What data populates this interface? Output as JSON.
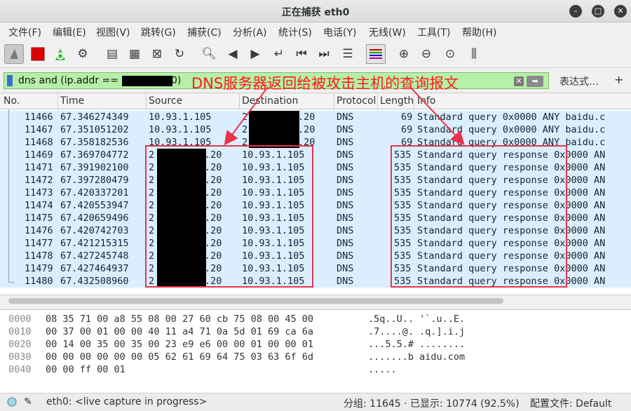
{
  "window": {
    "title": "正在捕获 eth0"
  },
  "menu": [
    "文件(F)",
    "编辑(E)",
    "视图(V)",
    "跳转(G)",
    "捕获(C)",
    "分析(A)",
    "统计(S)",
    "电话(Y)",
    "无线(W)",
    "工具(T)",
    "帮助(H)"
  ],
  "filter": {
    "text": "dns and (ip.addr == 2",
    "text_tail": "0)",
    "expression_label": "表达式…",
    "add_label": "+"
  },
  "annotation": {
    "label": "DNS服务器返回给被攻击主机的查询报文",
    "color": "#e8344a"
  },
  "columns": [
    "No.",
    "Time",
    "Source",
    "Destination",
    "Protocol",
    "Length",
    "Info"
  ],
  "packets": [
    {
      "no": "11466",
      "time": "67.346274349",
      "src": "10.93.1.105",
      "dst_head": "2",
      "dst_tail": ".20",
      "proto": "DNS",
      "len": "69",
      "info": "Standard query 0x0000 ANY baidu.c"
    },
    {
      "no": "11467",
      "time": "67.351051202",
      "src": "10.93.1.105",
      "dst_head": "2",
      "dst_tail": ".20",
      "proto": "DNS",
      "len": "69",
      "info": "Standard query 0x0000 ANY baidu.c"
    },
    {
      "no": "11468",
      "time": "67.358182536",
      "src": "10.93.1.105",
      "dst_head": "2",
      "dst_tail": ".20",
      "proto": "DNS",
      "len": "69",
      "info": "Standard query 0x0000 ANY baidu.c"
    },
    {
      "no": "11469",
      "time": "67.369704772",
      "src_head": "2",
      "src_tail": ".20",
      "dst": "10.93.1.105",
      "proto": "DNS",
      "len": "535",
      "info": "Standard query response 0x0000 AN"
    },
    {
      "no": "11471",
      "time": "67.391902100",
      "src_head": "2",
      "src_tail": ".20",
      "dst": "10.93.1.105",
      "proto": "DNS",
      "len": "535",
      "info": "Standard query response 0x0000 AN"
    },
    {
      "no": "11472",
      "time": "67.397280479",
      "src_head": "2",
      "src_tail": ".20",
      "dst": "10.93.1.105",
      "proto": "DNS",
      "len": "535",
      "info": "Standard query response 0x0000 AN"
    },
    {
      "no": "11473",
      "time": "67.420337201",
      "src_head": "2",
      "src_tail": ".20",
      "dst": "10.93.1.105",
      "proto": "DNS",
      "len": "535",
      "info": "Standard query response 0x0000 AN"
    },
    {
      "no": "11474",
      "time": "67.420553947",
      "src_head": "2",
      "src_tail": ".20",
      "dst": "10.93.1.105",
      "proto": "DNS",
      "len": "535",
      "info": "Standard query response 0x0000 AN"
    },
    {
      "no": "11475",
      "time": "67.420659496",
      "src_head": "2",
      "src_tail": ".20",
      "dst": "10.93.1.105",
      "proto": "DNS",
      "len": "535",
      "info": "Standard query response 0x0000 AN"
    },
    {
      "no": "11476",
      "time": "67.420742703",
      "src_head": "2",
      "src_tail": ".20",
      "dst": "10.93.1.105",
      "proto": "DNS",
      "len": "535",
      "info": "Standard query response 0x0000 AN"
    },
    {
      "no": "11477",
      "time": "67.421215315",
      "src_head": "2",
      "src_tail": ".20",
      "dst": "10.93.1.105",
      "proto": "DNS",
      "len": "535",
      "info": "Standard query response 0x0000 AN"
    },
    {
      "no": "11478",
      "time": "67.427245748",
      "src_head": "2",
      "src_tail": ".20",
      "dst": "10.93.1.105",
      "proto": "DNS",
      "len": "535",
      "info": "Standard query response 0x0000 AN"
    },
    {
      "no": "11479",
      "time": "67.427464937",
      "src_head": "2",
      "src_tail": ".20",
      "dst": "10.93.1.105",
      "proto": "DNS",
      "len": "535",
      "info": "Standard query response 0x0000 AN"
    },
    {
      "no": "11480",
      "time": "67.432508960",
      "src_head": "2",
      "src_tail": ".20",
      "dst": "10.93.1.105",
      "proto": "DNS",
      "len": "535",
      "info": "Standard query response 0x0000 AN"
    }
  ],
  "hex": [
    {
      "off": "0000",
      "bytes": "08 35 71 00 a8 55 08 00  27 60 cb 75 08 00 45 00",
      "ascii": ".5q..U.. '`.u..E."
    },
    {
      "off": "0010",
      "bytes": "00 37 00 01 00 00 40 11  a4 71 0a 5d 01 69 ca 6a",
      "ascii": ".7....@. .q.].i.j"
    },
    {
      "off": "0020",
      "bytes": "00 14 00 35 00 35 00 23  e9 e6 00 00 01 00 00 01",
      "ascii": "...5.5.# ........"
    },
    {
      "off": "0030",
      "bytes": "00 00 00 00 00 00 05 62  61 69 64 75 03 63 6f 6d",
      "ascii": ".......b aidu.com"
    },
    {
      "off": "0040",
      "bytes": "00 00 ff 00 01",
      "ascii": "....."
    }
  ],
  "status": {
    "interface": "eth0: <live capture in progress>",
    "counts": "分组: 11645 · 已显示: 10774 (92.5%)",
    "profile": "配置文件: Default"
  }
}
